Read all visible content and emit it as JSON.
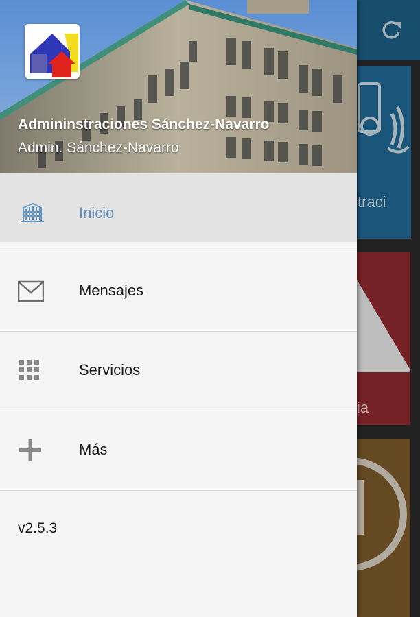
{
  "app": {
    "name": "Admininstraciones Sánchez-Navarro",
    "subtitle": "Admin. Sánchez-Navarro",
    "version": "v2.5.3"
  },
  "menu": {
    "items": [
      {
        "label": "Inicio",
        "icon": "building-icon",
        "active": true
      },
      {
        "label": "Mensajes",
        "icon": "envelope-icon",
        "active": false
      },
      {
        "label": "Servicios",
        "icon": "grid-icon",
        "active": false
      },
      {
        "label": "Más",
        "icon": "plus-icon",
        "active": false
      }
    ]
  },
  "background": {
    "refresh_icon": "refresh-icon",
    "cards": [
      {
        "label": "traci",
        "color": "#1f6a95"
      },
      {
        "label": "ia",
        "color": "#8f2a2f"
      },
      {
        "label": "",
        "color": "#7a5a2b"
      }
    ]
  },
  "colors": {
    "topbar": "#1d5f86",
    "active_text": "#5f93c4",
    "drawer_bg": "#f5f5f5"
  }
}
